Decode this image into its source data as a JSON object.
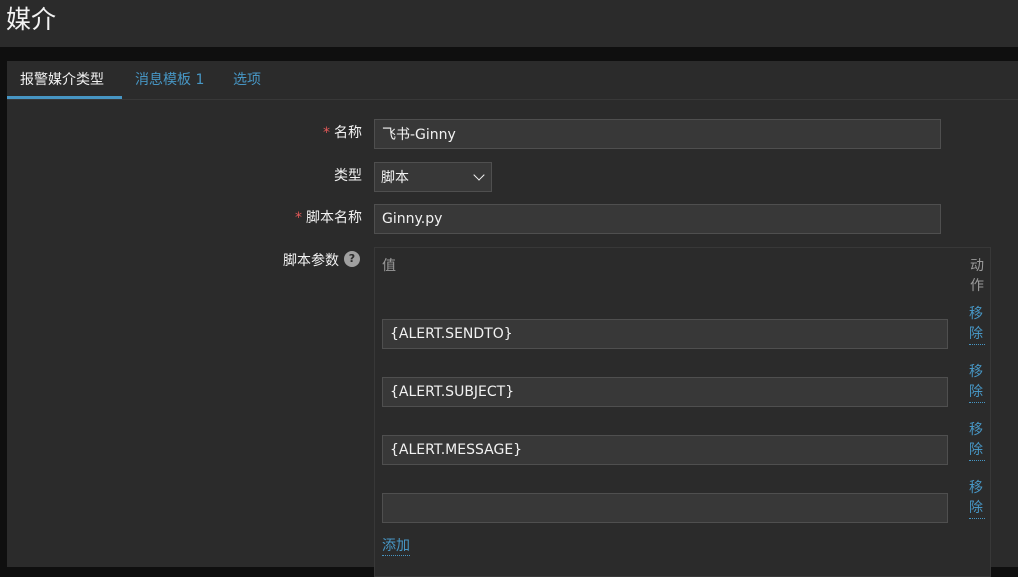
{
  "header": {
    "title": "媒介"
  },
  "tabs": [
    {
      "label": "报警媒介类型"
    },
    {
      "label": "消息模板 1"
    },
    {
      "label": "选项"
    }
  ],
  "form": {
    "name_label": "名称",
    "name_value": "飞书-Ginny",
    "type_label": "类型",
    "type_value": "脚本",
    "script_name_label": "脚本名称",
    "script_name_value": "Ginny.py",
    "script_params_label": "脚本参数",
    "help_glyph": "?",
    "required_mark": "*"
  },
  "params": {
    "value_header": "值",
    "action_header": "动作",
    "rows": [
      {
        "value": "{ALERT.SENDTO}",
        "remove_label": "移除"
      },
      {
        "value": "{ALERT.SUBJECT}",
        "remove_label": "移除"
      },
      {
        "value": "{ALERT.MESSAGE}",
        "remove_label": "移除"
      },
      {
        "value": "",
        "remove_label": "移除"
      }
    ],
    "add_label": "添加"
  },
  "colors": {
    "accent": "#4796c4",
    "required": "#e45959",
    "panel": "#2b2b2b",
    "input_bg": "#383838"
  }
}
